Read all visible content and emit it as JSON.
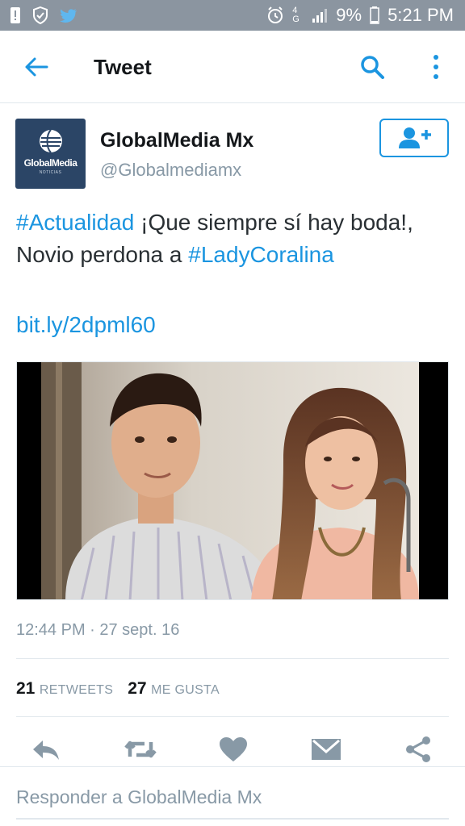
{
  "status_bar": {
    "battery": "9%",
    "time": "5:21 PM",
    "network": "4G"
  },
  "app_bar": {
    "title": "Tweet",
    "icons": [
      "back-arrow-icon",
      "search-icon",
      "more-vertical-icon"
    ]
  },
  "tweet": {
    "author": {
      "name": "GlobalMedia Mx",
      "handle": "@Globalmediamx",
      "avatar_brand": "GlobalMedia",
      "avatar_sub": "NOTICIAS"
    },
    "text": {
      "hashtag1": "#Actualidad",
      "body": " ¡Que siempre sí hay boda!, Novio perdona a ",
      "hashtag2": "#LadyCoralina",
      "link": "bit.ly/2dpml60"
    },
    "timestamp": "12:44 PM · 27 sept. 16",
    "stats": {
      "retweets_count": "21",
      "retweets_label": "RETWEETS",
      "likes_count": "27",
      "likes_label": "ME GUSTA"
    }
  },
  "reply_box": {
    "placeholder": "Responder a GlobalMedia Mx"
  },
  "colors": {
    "accent": "#1b95e0",
    "status_bar": "#8b95a0",
    "muted": "#8899a6",
    "action_icons": "#aab8c2"
  }
}
